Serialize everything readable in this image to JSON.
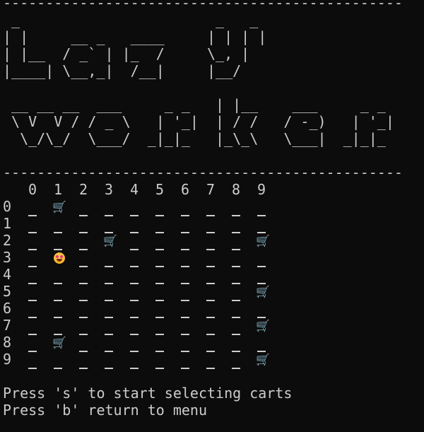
{
  "rule_top": "-----------------------------------------------",
  "banner_lines": [
    " _                       _   _",
    "| |     __ _   ____     | | | |",
    "| |__  / _` | |_  /     \\_, |",
    "|____| \\__,_|  /__|     |__/",
    "",
    " __ __ __  ___     _ _   | |__    ___     _ _",
    " \\ V  V / / _ \\   | '_|  | / /   / -_)   | '_|",
    "  \\_/\\_/  \\___/  _|_|_   |_\\_\\   \\___|  _|_|_"
  ],
  "rule_bottom": "-----------------------------------------------",
  "grid": {
    "column_labels": [
      "0",
      "1",
      "2",
      "3",
      "4",
      "5",
      "6",
      "7",
      "8",
      "9"
    ],
    "rows": [
      {
        "label": "0",
        "cells": [
          "_",
          "cart",
          "_",
          "_",
          "_",
          "_",
          "_",
          "_",
          "_",
          "_"
        ]
      },
      {
        "label": "1",
        "cells": [
          "_",
          "_",
          "_",
          "_",
          "_",
          "_",
          "_",
          "_",
          "_",
          "_"
        ]
      },
      {
        "label": "2",
        "cells": [
          "_",
          "_",
          "_",
          "cart",
          "_",
          "_",
          "_",
          "_",
          "_",
          "cart"
        ]
      },
      {
        "label": "3",
        "cells": [
          "_",
          "player",
          "_",
          "_",
          "_",
          "_",
          "_",
          "_",
          "_",
          "_"
        ]
      },
      {
        "label": "4",
        "cells": [
          "_",
          "_",
          "_",
          "_",
          "_",
          "_",
          "_",
          "_",
          "_",
          "_"
        ]
      },
      {
        "label": "5",
        "cells": [
          "_",
          "_",
          "_",
          "_",
          "_",
          "_",
          "_",
          "_",
          "_",
          "cart"
        ]
      },
      {
        "label": "6",
        "cells": [
          "_",
          "_",
          "_",
          "_",
          "_",
          "_",
          "_",
          "_",
          "_",
          "_"
        ]
      },
      {
        "label": "7",
        "cells": [
          "_",
          "_",
          "_",
          "_",
          "_",
          "_",
          "_",
          "_",
          "_",
          "cart"
        ]
      },
      {
        "label": "8",
        "cells": [
          "_",
          "cart",
          "_",
          "_",
          "_",
          "_",
          "_",
          "_",
          "_",
          "_"
        ]
      },
      {
        "label": "9",
        "cells": [
          "_",
          "_",
          "_",
          "_",
          "_",
          "_",
          "_",
          "_",
          "_",
          "cart"
        ]
      }
    ],
    "cart_glyph": "🛒",
    "cart_icon": "shopping-cart-icon",
    "player_icon": "star-struck-face-icon"
  },
  "footer": {
    "line1": "Press 's' to start selecting carts",
    "line2": "Press 'b' return to menu"
  },
  "colors": {
    "background": "#0c0c0c",
    "text": "#cccccc"
  }
}
